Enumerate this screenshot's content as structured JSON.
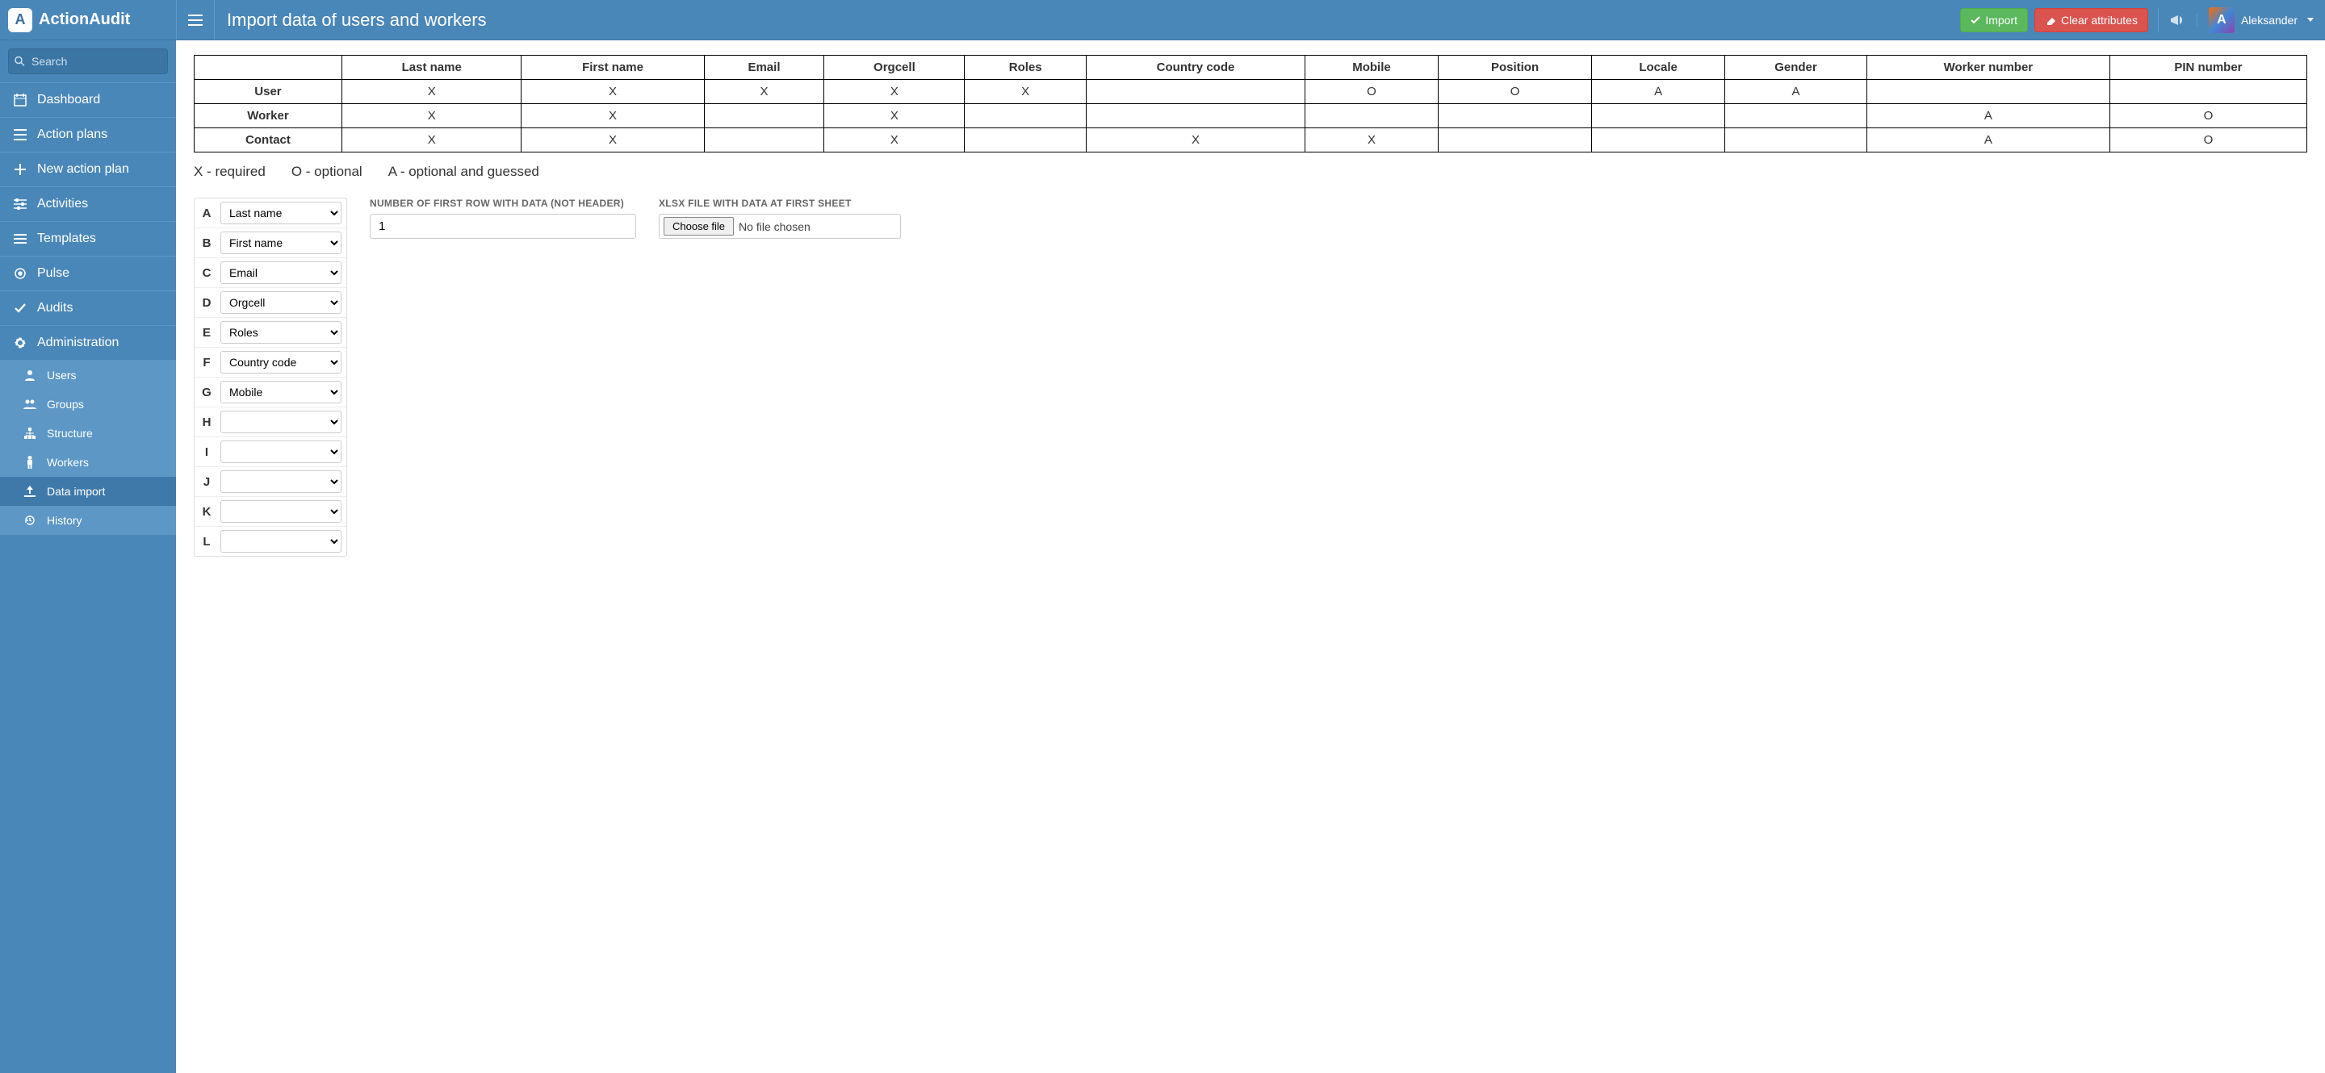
{
  "app": {
    "name": "ActionAudit"
  },
  "header": {
    "title": "Import data of users and workers",
    "import_label": "Import",
    "clear_label": "Clear attributes",
    "user_name": "Aleksander"
  },
  "sidebar": {
    "search_placeholder": "Search",
    "items": [
      {
        "label": "Dashboard",
        "icon": "calendar-icon"
      },
      {
        "label": "Action plans",
        "icon": "list-icon"
      },
      {
        "label": "New action plan",
        "icon": "plus-icon"
      },
      {
        "label": "Activities",
        "icon": "sliders-icon"
      },
      {
        "label": "Templates",
        "icon": "bars-icon"
      },
      {
        "label": "Pulse",
        "icon": "target-icon"
      },
      {
        "label": "Audits",
        "icon": "check-icon"
      },
      {
        "label": "Administration",
        "icon": "gear-icon"
      }
    ],
    "admin_subitems": [
      {
        "label": "Users",
        "icon": "user-icon",
        "active": false
      },
      {
        "label": "Groups",
        "icon": "group-icon",
        "active": false
      },
      {
        "label": "Structure",
        "icon": "tree-icon",
        "active": false
      },
      {
        "label": "Workers",
        "icon": "person-icon",
        "active": false
      },
      {
        "label": "Data import",
        "icon": "upload-icon",
        "active": true
      },
      {
        "label": "History",
        "icon": "history-icon",
        "active": false
      }
    ]
  },
  "spec_table": {
    "columns": [
      "Last name",
      "First name",
      "Email",
      "Orgcell",
      "Roles",
      "Country code",
      "Mobile",
      "Position",
      "Locale",
      "Gender",
      "Worker number",
      "PIN number"
    ],
    "rows": [
      {
        "label": "User",
        "cells": [
          "X",
          "X",
          "X",
          "X",
          "X",
          "",
          "O",
          "O",
          "A",
          "A",
          "",
          ""
        ]
      },
      {
        "label": "Worker",
        "cells": [
          "X",
          "X",
          "",
          "X",
          "",
          "",
          "",
          "",
          "",
          "",
          "A",
          "O"
        ]
      },
      {
        "label": "Contact",
        "cells": [
          "X",
          "X",
          "",
          "X",
          "",
          "X",
          "X",
          "",
          "",
          "",
          "A",
          "O"
        ]
      }
    ]
  },
  "legend": {
    "x": "X - required",
    "o": "O - optional",
    "a": "A - optional and guessed"
  },
  "column_map": {
    "select_options": [
      "",
      "Last name",
      "First name",
      "Email",
      "Orgcell",
      "Roles",
      "Country code",
      "Mobile",
      "Position",
      "Locale",
      "Gender",
      "Worker number",
      "PIN number"
    ],
    "rows": [
      {
        "letter": "A",
        "value": "Last name"
      },
      {
        "letter": "B",
        "value": "First name"
      },
      {
        "letter": "C",
        "value": "Email"
      },
      {
        "letter": "D",
        "value": "Orgcell"
      },
      {
        "letter": "E",
        "value": "Roles"
      },
      {
        "letter": "F",
        "value": "Country code"
      },
      {
        "letter": "G",
        "value": "Mobile"
      },
      {
        "letter": "H",
        "value": ""
      },
      {
        "letter": "I",
        "value": ""
      },
      {
        "letter": "J",
        "value": ""
      },
      {
        "letter": "K",
        "value": ""
      },
      {
        "letter": "L",
        "value": ""
      }
    ]
  },
  "first_row_field": {
    "label": "NUMBER OF FIRST ROW WITH DATA (NOT HEADER)",
    "value": "1"
  },
  "file_field": {
    "label": "XLSX FILE WITH DATA AT FIRST SHEET",
    "button": "Choose file",
    "status": "No file chosen"
  }
}
